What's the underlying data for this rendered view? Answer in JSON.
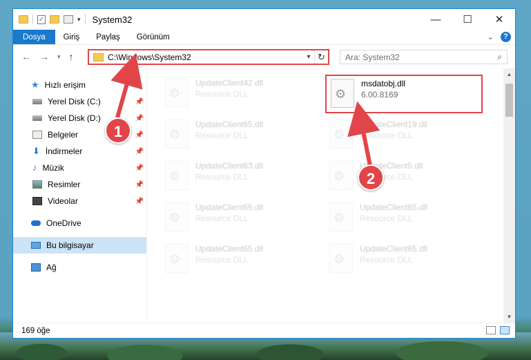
{
  "window": {
    "title": "System32",
    "buttons": {
      "minimize": "—",
      "maximize": "☐",
      "close": "✕"
    }
  },
  "ribbon": {
    "tabs": [
      "Dosya",
      "Giriş",
      "Paylaş",
      "Görünüm"
    ]
  },
  "address": {
    "path": "C:\\Windows\\System32"
  },
  "search": {
    "placeholder": "Ara: System32"
  },
  "sidebar": {
    "quick_access": "Hızlı erişim",
    "items": [
      {
        "label": "Yerel Disk (C:)",
        "icon": "disk-icon"
      },
      {
        "label": "Yerel Disk (D:)",
        "icon": "disk-icon"
      },
      {
        "label": "Belgeler",
        "icon": "documents-icon"
      },
      {
        "label": "İndirmeler",
        "icon": "download-icon"
      },
      {
        "label": "Müzik",
        "icon": "music-icon"
      },
      {
        "label": "Resimler",
        "icon": "pictures-icon"
      },
      {
        "label": "Videolar",
        "icon": "videos-icon"
      }
    ],
    "onedrive": "OneDrive",
    "this_pc": "Bu bilgisayar",
    "network": "Ağ"
  },
  "files": [
    {
      "name": "UpdateClient42.dll",
      "desc": "Resource DLL"
    },
    {
      "name": "msdatobj.dll",
      "desc": "6.00.8169"
    },
    {
      "name": "UpdateClient65.dll",
      "desc": "Resource DLL"
    },
    {
      "name": "UpdateClient19.dll",
      "desc": "Resource DLL"
    },
    {
      "name": "UpdateClient63.dll",
      "desc": "Resource DLL"
    },
    {
      "name": "UpdateClient5.dll",
      "desc": "Resource DLL"
    },
    {
      "name": "UpdateClient65.dll",
      "desc": "Resource DLL"
    },
    {
      "name": "UpdateClient65.dll",
      "desc": "Resource DLL"
    },
    {
      "name": "UpdateClient65.dll",
      "desc": "Resource DLL"
    },
    {
      "name": "UpdateClient65.dll",
      "desc": "Resource DLL"
    }
  ],
  "status": {
    "count": "169 öğe"
  },
  "annotations": {
    "step1": "1",
    "step2": "2",
    "color": "#e14549"
  }
}
